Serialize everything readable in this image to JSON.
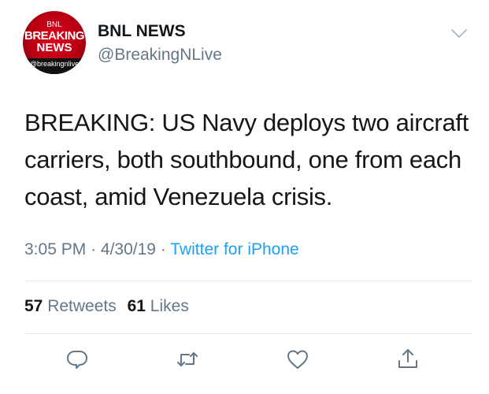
{
  "account": {
    "name": "BNL NEWS",
    "handle": "@BreakingNLive",
    "avatar": {
      "top_text": "BNL",
      "line1": "BREAKING",
      "line2": "NEWS",
      "handle_text": "@breakingnlive"
    }
  },
  "tweet": {
    "text": "BREAKING: US Navy deploys two aircraft carriers, both southbound, one from each coast, amid Venezuela crisis.",
    "time": "3:05 PM",
    "date": "4/30/19",
    "separator": "·",
    "source": "Twitter for iPhone"
  },
  "stats": {
    "retweets_count": "57",
    "retweets_label": "Retweets",
    "likes_count": "61",
    "likes_label": "Likes"
  },
  "actions": [
    "reply-icon",
    "retweet-icon",
    "like-icon",
    "share-icon"
  ],
  "colors": {
    "text": "#14171a",
    "secondary": "#657786",
    "link": "#1da1f2",
    "divider": "#e1e8ed",
    "avatar_red": "#d0021b"
  }
}
